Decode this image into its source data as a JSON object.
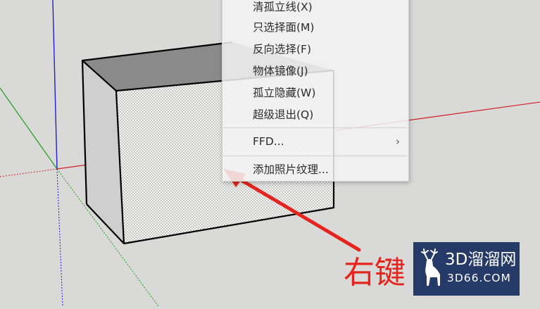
{
  "context_menu": {
    "items": [
      {
        "label": "清孤立线(X)"
      },
      {
        "label": "只选择面(M)"
      },
      {
        "label": "反向选择(F)"
      },
      {
        "label": "物体镜像(J)"
      },
      {
        "label": "孤立隐藏(W)"
      },
      {
        "label": "超级退出(Q)"
      },
      {
        "label": "FFD...",
        "submenu_arrow": "›"
      },
      {
        "label": "添加照片纹理..."
      }
    ]
  },
  "annotation": {
    "text": "右键",
    "color": "#e6241e"
  },
  "watermark": {
    "brand": "3D溜溜网",
    "domain": "3D66.COM",
    "background": "#253a66"
  },
  "colors": {
    "viewport_background": "#d9d9d7",
    "axis_red": "#d02020",
    "axis_green": "#1aa01a",
    "axis_blue": "#2020d0"
  },
  "icons": [
    "deer-logo-icon",
    "submenu-arrow-icon"
  ]
}
